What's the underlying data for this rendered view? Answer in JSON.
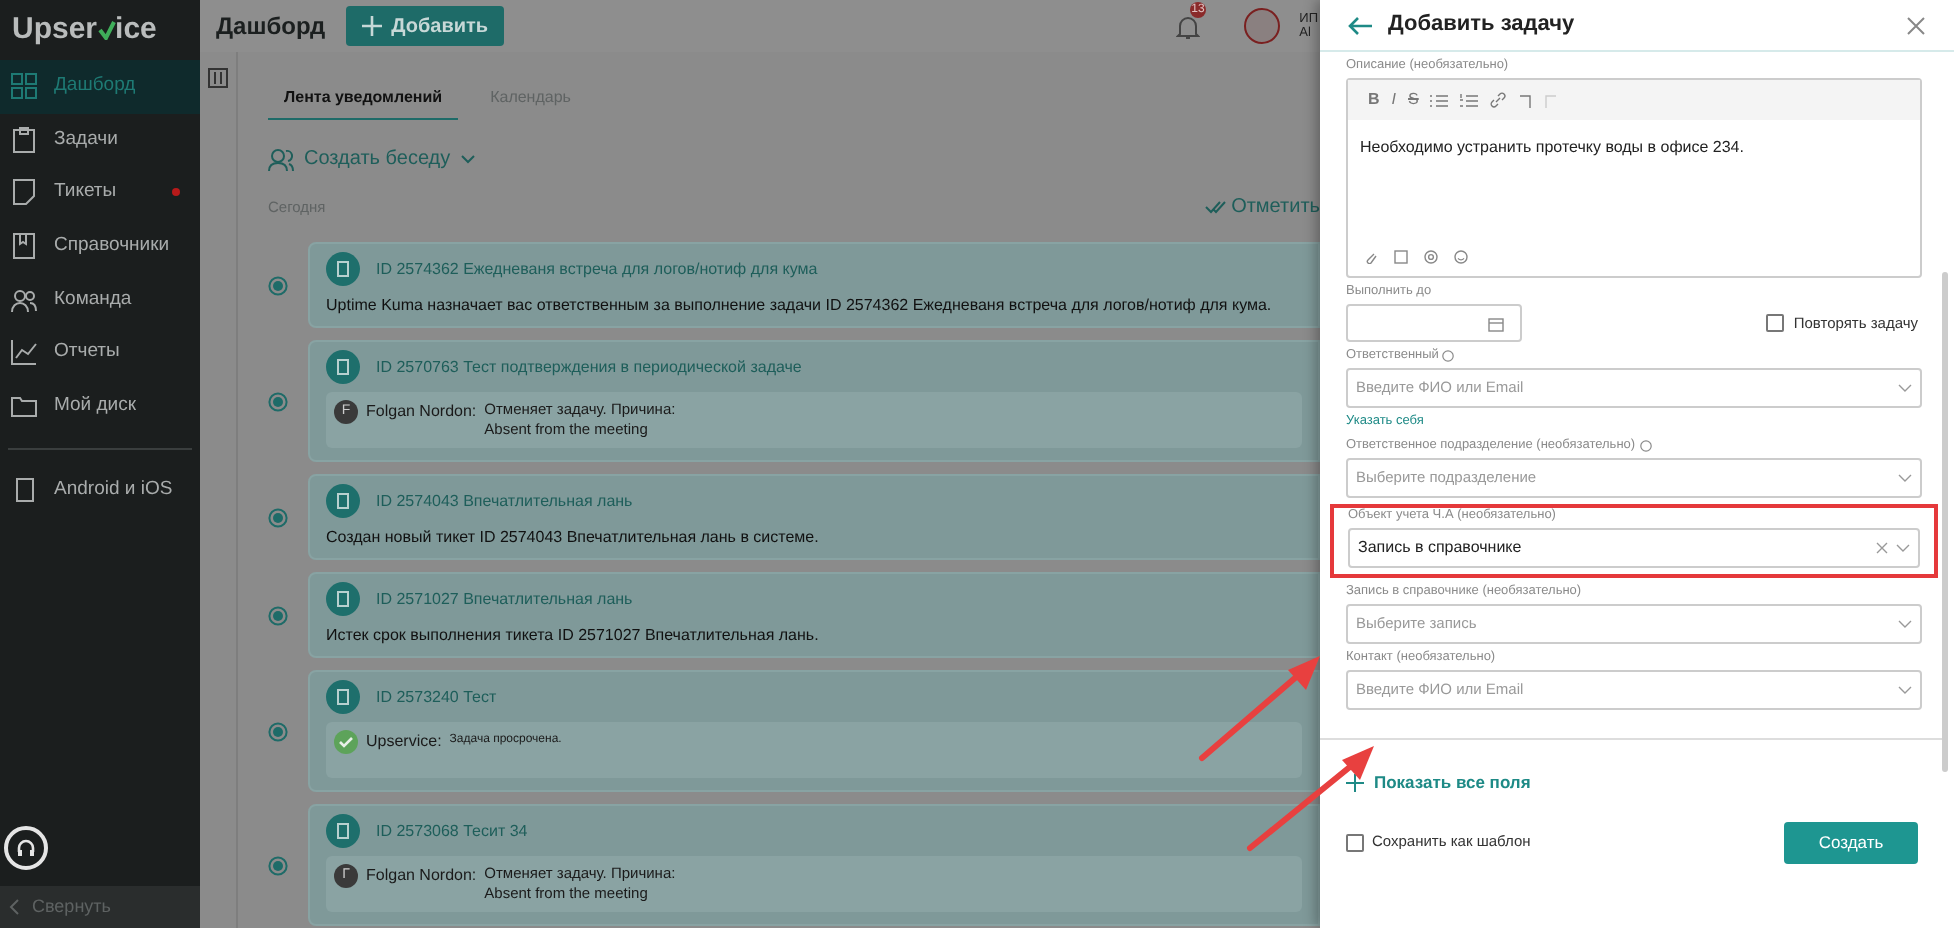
{
  "logo": {
    "text_before": "Upser",
    "text_after": "ice"
  },
  "sidebar": {
    "items": [
      {
        "label": "Дашборд",
        "selected": true,
        "badge_dot": false
      },
      {
        "label": "Задачи",
        "selected": false,
        "badge_dot": false
      },
      {
        "label": "Тикеты",
        "selected": false,
        "badge_dot": true
      },
      {
        "label": "Справочники",
        "selected": false,
        "badge_dot": false
      },
      {
        "label": "Команда",
        "selected": false,
        "badge_dot": false
      },
      {
        "label": "Отчеты",
        "selected": false,
        "badge_dot": false
      },
      {
        "label": "Мой диск",
        "selected": false,
        "badge_dot": false
      }
    ],
    "apps_link": "Android и iOS",
    "collapse": "Свернуть"
  },
  "header": {
    "title": "Дашборд",
    "add_button": "Добавить",
    "notification_count": "13",
    "user_line_1": "ИП",
    "user_line_2": "Al"
  },
  "tabs": [
    {
      "label": "Лента уведомлений",
      "selected": true
    },
    {
      "label": "Календарь",
      "selected": false
    }
  ],
  "create_chat": "Создать беседу",
  "section": "Сегодня",
  "mark_read": "Отметить",
  "feed": [
    {
      "kind": "text",
      "title": "ID 2574362 Ежедневаня встреча для логов/нотиф для кума",
      "body": "Uptime Kuma назначает вас ответственным за выполнение задачи ID 2574362 Ежедневаня встреча для логов/нотиф для кума."
    },
    {
      "kind": "comment",
      "title": "ID 2570763 Тест подтверждения в периодической задаче",
      "avatar": "F",
      "author": "Folgan Nordon:",
      "lines": [
        "Отменяет задачу. Причина:",
        "Absent from the meeting"
      ]
    },
    {
      "kind": "text",
      "title": "ID 2574043 Впечатлительная лань",
      "body": "Создан новый тикет ID 2574043 Впечатлительная лань в системе."
    },
    {
      "kind": "text",
      "title": "ID 2571027 Впечатлительная лань",
      "body": "Истек срок выполнения тикета ID 2571027 Впечатлительная лань."
    },
    {
      "kind": "system",
      "title": "ID 2573240 Тест",
      "author": "Upservice:",
      "lines": [
        "Задача просрочена."
      ]
    },
    {
      "kind": "comment",
      "title": "ID 2573068 Тесит 34",
      "avatar": "Г",
      "author": "Folgan Nordon:",
      "lines": [
        "Отменяет задачу. Причина:",
        "Absent from the meeting"
      ]
    }
  ],
  "panel": {
    "title": "Добавить задачу",
    "fields": [
      {
        "kind": "editor",
        "label": "Описание (необязательно)",
        "toolbar": [
          "B",
          "I",
          "S"
        ],
        "value": "Необходимо устранить протечку воды в офисе 234."
      },
      {
        "kind": "date",
        "label": "Выполнить до",
        "checkbox": "Повторять задачу",
        "checked": false
      },
      {
        "kind": "select",
        "label": "Ответственный",
        "help": true,
        "placeholder": "Введите ФИО или Email",
        "link": "Указать себя"
      },
      {
        "kind": "select",
        "label": "Ответственное подразделение (необязательно)",
        "help": true,
        "placeholder": "Выберите подразделение"
      },
      {
        "kind": "select",
        "label": "Объект учета Ч.А (необязательно)",
        "value": "Запись в справочнике",
        "clearable": true,
        "highlighted": true
      },
      {
        "kind": "select",
        "label": "Запись в справочнике (необязательно)",
        "placeholder": "Выберите запись"
      },
      {
        "kind": "select",
        "label": "Контакт (необязательно)",
        "placeholder": "Введите ФИО или Email"
      }
    ],
    "show_all": "Показать все поля",
    "save_template": "Сохранить как шаблон",
    "save_checked": false,
    "submit": "Создать"
  }
}
